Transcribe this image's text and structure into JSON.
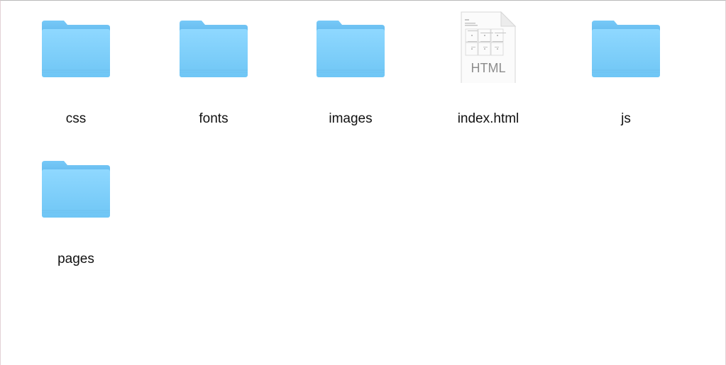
{
  "finder": {
    "items": [
      {
        "name": "css",
        "kind": "folder",
        "icon": "folder-icon"
      },
      {
        "name": "fonts",
        "kind": "folder",
        "icon": "folder-icon"
      },
      {
        "name": "images",
        "kind": "folder",
        "icon": "folder-icon"
      },
      {
        "name": "index.html",
        "kind": "file",
        "icon": "html-file-icon",
        "badge": "HTML"
      },
      {
        "name": "js",
        "kind": "folder",
        "icon": "folder-icon"
      },
      {
        "name": "pages",
        "kind": "folder",
        "icon": "folder-icon"
      }
    ]
  },
  "colors": {
    "folder_front": "#7fcff8",
    "folder_back": "#62b7ea",
    "label_text": "#111111",
    "file_badge_text": "#8d8d8d"
  }
}
